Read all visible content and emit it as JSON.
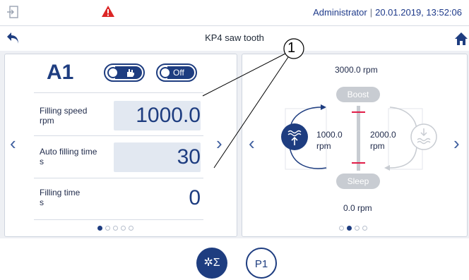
{
  "header": {
    "user": "Administrator",
    "separator": "|",
    "datetime": "20.01.2019, 13:52:06"
  },
  "title": "KP4 saw tooth",
  "left_panel": {
    "drive": "A1",
    "toggle_off_label": "Off",
    "params": [
      {
        "label": "Filling speed",
        "unit": "rpm",
        "value": "1000.0"
      },
      {
        "label": "Auto filling time",
        "unit": "s",
        "value": "30"
      },
      {
        "label": "Filling time",
        "unit": "s",
        "value": "0"
      }
    ],
    "page_dots": 5,
    "active_dot": 0
  },
  "right_panel": {
    "max_rpm": "3000.0 rpm",
    "min_rpm": "0.0 rpm",
    "left_value": "1000.0",
    "left_unit": "rpm",
    "right_value": "2000.0",
    "right_unit": "rpm",
    "boost_label": "Boost",
    "sleep_label": "Sleep",
    "page_dots": 4,
    "active_dot": 1
  },
  "bottom": {
    "sum_label": "Σ",
    "p1_label": "P1"
  },
  "callout": "1",
  "colors": {
    "primary": "#1e3d80",
    "warning": "#dc2626",
    "marker": "#e11d48",
    "pill": "#c8ccd2"
  }
}
